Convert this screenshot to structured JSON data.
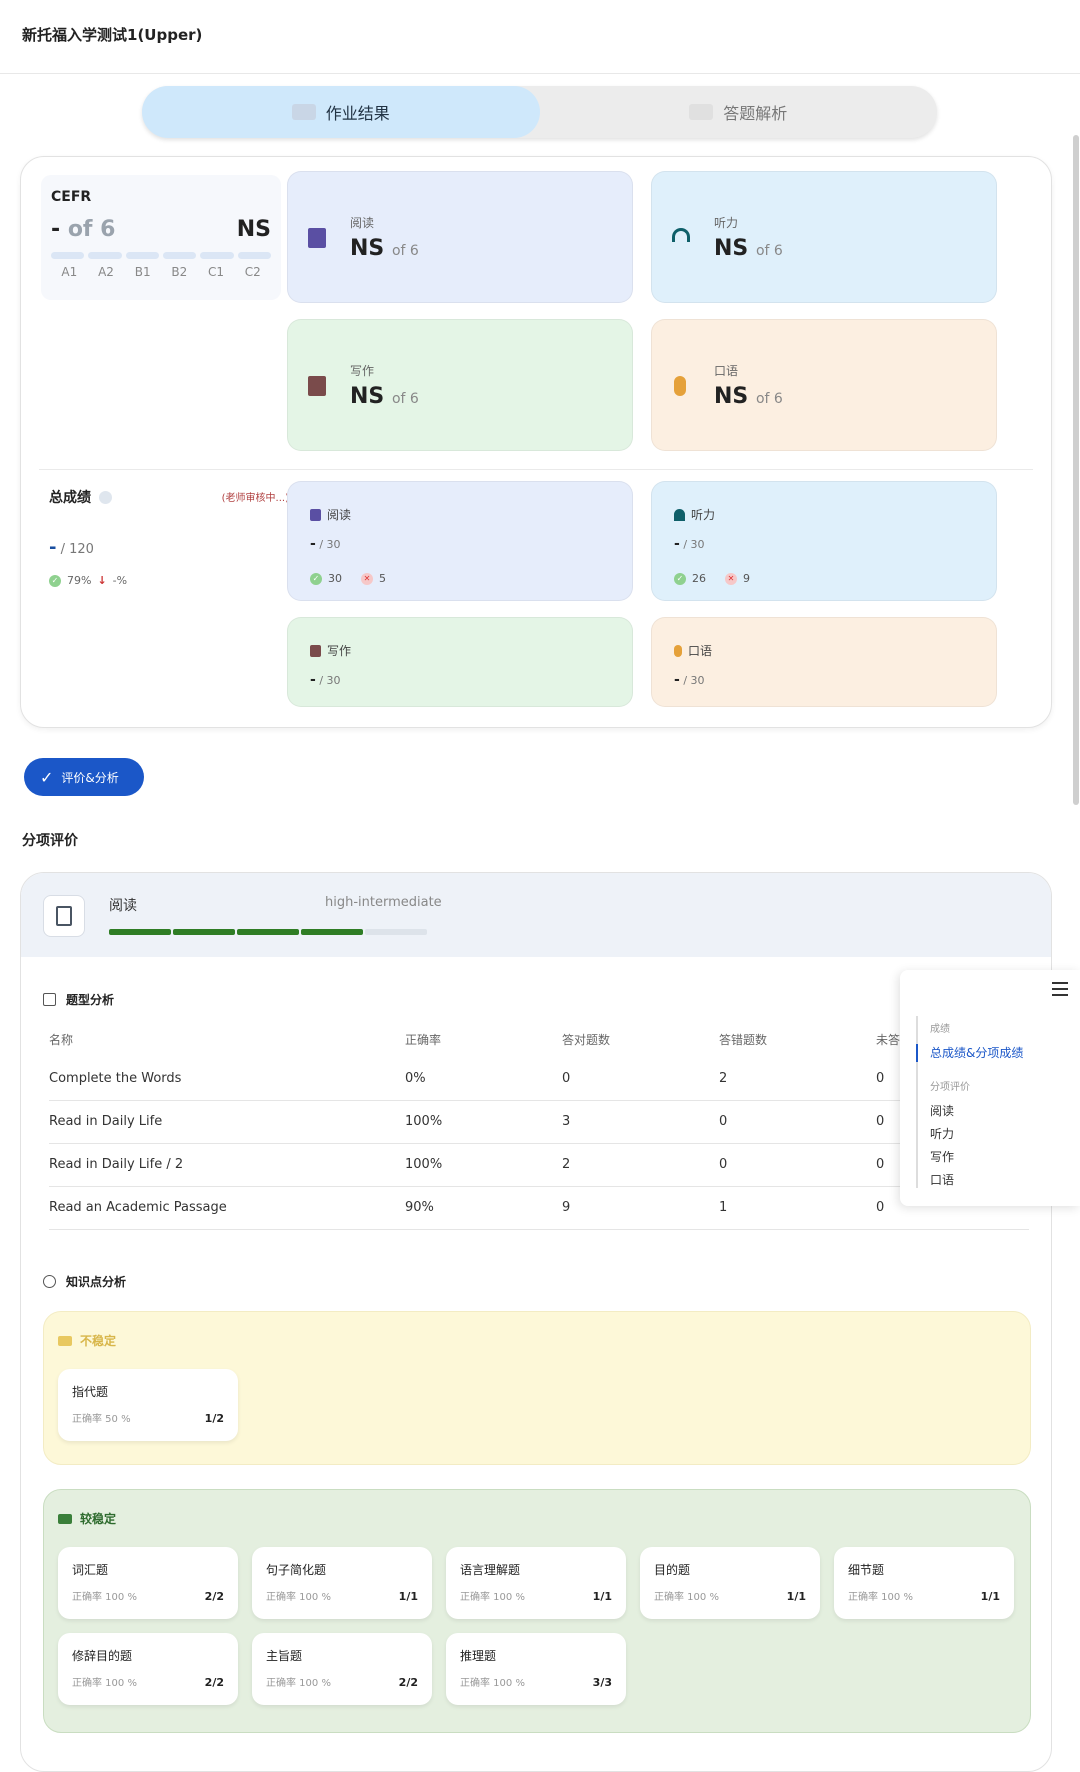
{
  "page_title": "新托福入学测试1(Upper)",
  "tabs": [
    {
      "label": "作业结果",
      "active": true
    },
    {
      "label": "答题解析",
      "active": false
    }
  ],
  "cefr": {
    "label": "CEFR",
    "score": "-",
    "of": "of 6",
    "value": "NS",
    "levels": [
      "A1",
      "A2",
      "B1",
      "B2",
      "C1",
      "C2"
    ]
  },
  "skills": [
    {
      "name": "阅读",
      "score": "NS",
      "of": "of 6",
      "icon": "book-icon"
    },
    {
      "name": "听力",
      "score": "NS",
      "of": "of 6",
      "icon": "headphones-icon"
    },
    {
      "name": "写作",
      "score": "NS",
      "of": "of 6",
      "icon": "pencil-note-icon"
    },
    {
      "name": "口语",
      "score": "NS",
      "of": "of 6",
      "icon": "microphone-icon"
    }
  ],
  "total": {
    "label": "总成绩",
    "review": "(老师审核中...)",
    "value": "-",
    "max": "/ 120",
    "accuracy": "79%",
    "change": "-%"
  },
  "section_scores": [
    {
      "name": "阅读",
      "value": "-",
      "max": "/ 30",
      "correct": "30",
      "wrong": "5"
    },
    {
      "name": "听力",
      "value": "-",
      "max": "/ 30",
      "correct": "26",
      "wrong": "9"
    },
    {
      "name": "写作",
      "value": "-",
      "max": "/ 30"
    },
    {
      "name": "口语",
      "value": "-",
      "max": "/ 30"
    }
  ],
  "eval_button": "评价&分析",
  "section_title": "分项评价",
  "reading_panel": {
    "name": "阅读",
    "level": "high-intermediate",
    "progress_filled": 4,
    "progress_total": 5
  },
  "question_analysis": {
    "title": "题型分析",
    "headers": [
      "名称",
      "正确率",
      "答对题数",
      "答错题数",
      "未答"
    ],
    "rows": [
      [
        "Complete the Words",
        "0%",
        "0",
        "2",
        "0"
      ],
      [
        "Read in Daily Life",
        "100%",
        "3",
        "0",
        "0"
      ],
      [
        "Read in Daily Life / 2",
        "100%",
        "2",
        "0",
        "0"
      ],
      [
        "Read an Academic Passage",
        "90%",
        "9",
        "1",
        "0"
      ]
    ]
  },
  "knowledge": {
    "title": "知识点分析",
    "unstable_label": "不稳定",
    "unstable": [
      {
        "name": "指代题",
        "rate": "正确率 50 %",
        "frac": "1/2"
      }
    ],
    "stable_label": "较稳定",
    "stable": [
      {
        "name": "词汇题",
        "rate": "正确率 100 %",
        "frac": "2/2"
      },
      {
        "name": "句子简化题",
        "rate": "正确率 100 %",
        "frac": "1/1"
      },
      {
        "name": "语言理解题",
        "rate": "正确率 100 %",
        "frac": "1/1"
      },
      {
        "name": "目的题",
        "rate": "正确率 100 %",
        "frac": "1/1"
      },
      {
        "name": "细节题",
        "rate": "正确率 100 %",
        "frac": "1/1"
      },
      {
        "name": "修辞目的题",
        "rate": "正确率 100 %",
        "frac": "2/2"
      },
      {
        "name": "主旨题",
        "rate": "正确率 100 %",
        "frac": "2/2"
      },
      {
        "name": "推理题",
        "rate": "正确率 100 %",
        "frac": "3/3"
      }
    ]
  },
  "toc": {
    "group1": "成绩",
    "active_item": "总成绩&分项成绩",
    "group2": "分项评价",
    "items": [
      "阅读",
      "听力",
      "写作",
      "口语"
    ]
  }
}
